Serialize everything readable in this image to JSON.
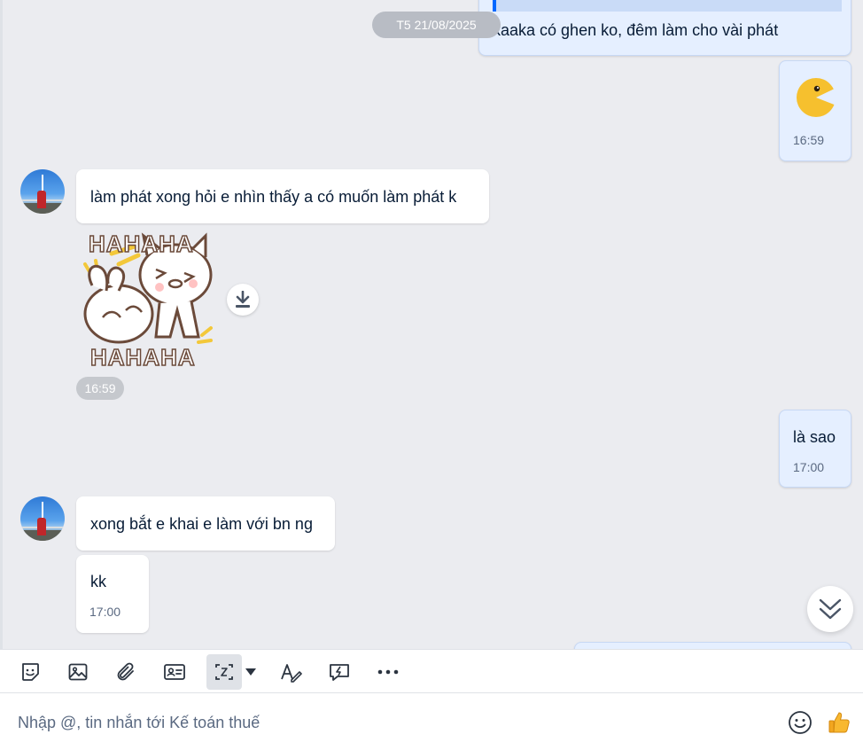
{
  "date_separator": "T5 21/08/2025",
  "messages": [
    {
      "side": "out",
      "text": "kaaka có ghen ko, đêm làm cho vài phát",
      "quoted": true
    },
    {
      "side": "out",
      "type": "emoji",
      "emoji": "pacman-emoji",
      "time": "16:59"
    },
    {
      "side": "in",
      "text": "làm phát xong hỏi e nhìn thấy a có muốn làm phát k"
    },
    {
      "side": "in",
      "type": "sticker",
      "sticker_text_top": "HAHAHA",
      "sticker_text_bottom": "HAHAHA",
      "time": "16:59"
    },
    {
      "side": "out",
      "text": "là sao",
      "time": "17:00"
    },
    {
      "side": "in",
      "text": "xong bắt e khai e làm với bn ng"
    },
    {
      "side": "in",
      "text": "kk",
      "time": "17:00"
    }
  ],
  "toolbar": {
    "items": [
      "sticker-icon",
      "image-icon",
      "attachment-icon",
      "contact-card-icon",
      "screenshot-icon",
      "dropdown-arrow-icon",
      "text-format-icon",
      "quick-message-icon",
      "more-icon"
    ]
  },
  "composer": {
    "placeholder": "Nhập @, tin nhắn tới Kế toán thuế"
  },
  "colors": {
    "background": "#ebecf0",
    "incoming_bubble": "#ffffff",
    "outgoing_bubble": "#e5efff",
    "accent": "#0068ff"
  }
}
